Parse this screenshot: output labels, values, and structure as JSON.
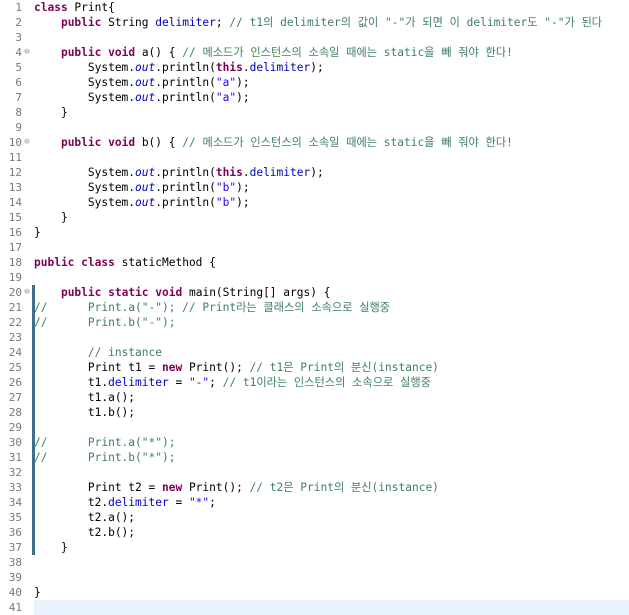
{
  "editor": {
    "language": "java",
    "colors": {
      "keyword": "#7f0055",
      "field": "#0000c0",
      "string": "#2a00ff",
      "comment": "#3f7f5f",
      "line_number": "#787878",
      "current_line": "#e8f2fe",
      "change_marker": "#3d6f8a"
    },
    "fold_icon": "collapse-minus-icon",
    "current_line": 41,
    "lines": [
      {
        "n": "1",
        "fold": false,
        "mark": false,
        "tokens": [
          {
            "t": "kw",
            "v": "class"
          },
          {
            "t": "p",
            "v": " Print{"
          }
        ]
      },
      {
        "n": "2",
        "fold": false,
        "mark": false,
        "tokens": [
          {
            "t": "p",
            "v": "    "
          },
          {
            "t": "kw",
            "v": "public"
          },
          {
            "t": "p",
            "v": " String "
          },
          {
            "t": "fld",
            "v": "delimiter"
          },
          {
            "t": "p",
            "v": "; "
          },
          {
            "t": "cm",
            "v": "// t1의 delimiter의 값이 \"-\"가 되면 이 delimiter도 \"-\"가 된다"
          }
        ]
      },
      {
        "n": "3",
        "fold": false,
        "mark": false,
        "tokens": []
      },
      {
        "n": "4",
        "fold": true,
        "mark": false,
        "tokens": [
          {
            "t": "p",
            "v": "    "
          },
          {
            "t": "kw",
            "v": "public"
          },
          {
            "t": "p",
            "v": " "
          },
          {
            "t": "kw",
            "v": "void"
          },
          {
            "t": "p",
            "v": " a() { "
          },
          {
            "t": "cm",
            "v": "// 메소드가 인스턴스의 소속일 때에는 static을 빼 줘야 한다!"
          }
        ]
      },
      {
        "n": "5",
        "fold": false,
        "mark": false,
        "tokens": [
          {
            "t": "p",
            "v": "        System."
          },
          {
            "t": "sfld",
            "v": "out"
          },
          {
            "t": "p",
            "v": ".println("
          },
          {
            "t": "kw",
            "v": "this"
          },
          {
            "t": "p",
            "v": "."
          },
          {
            "t": "fld",
            "v": "delimiter"
          },
          {
            "t": "p",
            "v": ");"
          }
        ]
      },
      {
        "n": "6",
        "fold": false,
        "mark": false,
        "tokens": [
          {
            "t": "p",
            "v": "        System."
          },
          {
            "t": "sfld",
            "v": "out"
          },
          {
            "t": "p",
            "v": ".println("
          },
          {
            "t": "str",
            "v": "\"a\""
          },
          {
            "t": "p",
            "v": ");"
          }
        ]
      },
      {
        "n": "7",
        "fold": false,
        "mark": false,
        "tokens": [
          {
            "t": "p",
            "v": "        System."
          },
          {
            "t": "sfld",
            "v": "out"
          },
          {
            "t": "p",
            "v": ".println("
          },
          {
            "t": "str",
            "v": "\"a\""
          },
          {
            "t": "p",
            "v": ");"
          }
        ]
      },
      {
        "n": "8",
        "fold": false,
        "mark": false,
        "tokens": [
          {
            "t": "p",
            "v": "    }"
          }
        ]
      },
      {
        "n": "9",
        "fold": false,
        "mark": false,
        "tokens": []
      },
      {
        "n": "10",
        "fold": true,
        "mark": false,
        "tokens": [
          {
            "t": "p",
            "v": "    "
          },
          {
            "t": "kw",
            "v": "public"
          },
          {
            "t": "p",
            "v": " "
          },
          {
            "t": "kw",
            "v": "void"
          },
          {
            "t": "p",
            "v": " b() { "
          },
          {
            "t": "cm",
            "v": "// 메소드가 인스턴스의 소속일 때에는 static을 빼 줘야 한다!"
          }
        ]
      },
      {
        "n": "11",
        "fold": false,
        "mark": false,
        "tokens": []
      },
      {
        "n": "12",
        "fold": false,
        "mark": false,
        "tokens": [
          {
            "t": "p",
            "v": "        System."
          },
          {
            "t": "sfld",
            "v": "out"
          },
          {
            "t": "p",
            "v": ".println("
          },
          {
            "t": "kw",
            "v": "this"
          },
          {
            "t": "p",
            "v": "."
          },
          {
            "t": "fld",
            "v": "delimiter"
          },
          {
            "t": "p",
            "v": ");"
          }
        ]
      },
      {
        "n": "13",
        "fold": false,
        "mark": false,
        "tokens": [
          {
            "t": "p",
            "v": "        System."
          },
          {
            "t": "sfld",
            "v": "out"
          },
          {
            "t": "p",
            "v": ".println("
          },
          {
            "t": "str",
            "v": "\"b\""
          },
          {
            "t": "p",
            "v": ");"
          }
        ]
      },
      {
        "n": "14",
        "fold": false,
        "mark": false,
        "tokens": [
          {
            "t": "p",
            "v": "        System."
          },
          {
            "t": "sfld",
            "v": "out"
          },
          {
            "t": "p",
            "v": ".println("
          },
          {
            "t": "str",
            "v": "\"b\""
          },
          {
            "t": "p",
            "v": ");"
          }
        ]
      },
      {
        "n": "15",
        "fold": false,
        "mark": false,
        "tokens": [
          {
            "t": "p",
            "v": "    }"
          }
        ]
      },
      {
        "n": "16",
        "fold": false,
        "mark": false,
        "tokens": [
          {
            "t": "p",
            "v": "}"
          }
        ]
      },
      {
        "n": "17",
        "fold": false,
        "mark": false,
        "tokens": []
      },
      {
        "n": "18",
        "fold": false,
        "mark": false,
        "tokens": [
          {
            "t": "kw",
            "v": "public"
          },
          {
            "t": "p",
            "v": " "
          },
          {
            "t": "kw",
            "v": "class"
          },
          {
            "t": "p",
            "v": " staticMethod {"
          }
        ]
      },
      {
        "n": "19",
        "fold": false,
        "mark": false,
        "tokens": []
      },
      {
        "n": "20",
        "fold": true,
        "mark": true,
        "tokens": [
          {
            "t": "p",
            "v": "    "
          },
          {
            "t": "kw",
            "v": "public"
          },
          {
            "t": "p",
            "v": " "
          },
          {
            "t": "kw",
            "v": "static"
          },
          {
            "t": "p",
            "v": " "
          },
          {
            "t": "kw",
            "v": "void"
          },
          {
            "t": "p",
            "v": " main(String[] args) {"
          }
        ]
      },
      {
        "n": "21",
        "fold": false,
        "mark": true,
        "tokens": [
          {
            "t": "cm",
            "v": "//      Print.a(\"-\"); // Print라는 클래스의 소속으로 실행중"
          }
        ]
      },
      {
        "n": "22",
        "fold": false,
        "mark": true,
        "tokens": [
          {
            "t": "cm",
            "v": "//      Print.b(\"-\");"
          }
        ]
      },
      {
        "n": "23",
        "fold": false,
        "mark": true,
        "tokens": []
      },
      {
        "n": "24",
        "fold": false,
        "mark": true,
        "tokens": [
          {
            "t": "p",
            "v": "        "
          },
          {
            "t": "cm",
            "v": "// instance"
          }
        ]
      },
      {
        "n": "25",
        "fold": false,
        "mark": true,
        "tokens": [
          {
            "t": "p",
            "v": "        Print t1 = "
          },
          {
            "t": "kw",
            "v": "new"
          },
          {
            "t": "p",
            "v": " Print(); "
          },
          {
            "t": "cm",
            "v": "// t1은 Print의 분신(instance)"
          }
        ]
      },
      {
        "n": "26",
        "fold": false,
        "mark": true,
        "tokens": [
          {
            "t": "p",
            "v": "        t1."
          },
          {
            "t": "fld",
            "v": "delimiter"
          },
          {
            "t": "p",
            "v": " = "
          },
          {
            "t": "str",
            "v": "\"-\""
          },
          {
            "t": "p",
            "v": "; "
          },
          {
            "t": "cm",
            "v": "// t1이라는 인스턴스의 소속으로 실행중"
          }
        ]
      },
      {
        "n": "27",
        "fold": false,
        "mark": true,
        "tokens": [
          {
            "t": "p",
            "v": "        t1.a();"
          }
        ]
      },
      {
        "n": "28",
        "fold": false,
        "mark": true,
        "tokens": [
          {
            "t": "p",
            "v": "        t1.b();"
          }
        ]
      },
      {
        "n": "29",
        "fold": false,
        "mark": true,
        "tokens": []
      },
      {
        "n": "30",
        "fold": false,
        "mark": true,
        "tokens": [
          {
            "t": "cm",
            "v": "//      Print.a(\"*\");"
          }
        ]
      },
      {
        "n": "31",
        "fold": false,
        "mark": true,
        "tokens": [
          {
            "t": "cm",
            "v": "//      Print.b(\"*\");"
          }
        ]
      },
      {
        "n": "32",
        "fold": false,
        "mark": true,
        "tokens": []
      },
      {
        "n": "33",
        "fold": false,
        "mark": true,
        "tokens": [
          {
            "t": "p",
            "v": "        Print t2 = "
          },
          {
            "t": "kw",
            "v": "new"
          },
          {
            "t": "p",
            "v": " Print(); "
          },
          {
            "t": "cm",
            "v": "// t2은 Print의 분신(instance)"
          }
        ]
      },
      {
        "n": "34",
        "fold": false,
        "mark": true,
        "tokens": [
          {
            "t": "p",
            "v": "        t2."
          },
          {
            "t": "fld",
            "v": "delimiter"
          },
          {
            "t": "p",
            "v": " = "
          },
          {
            "t": "str",
            "v": "\"*\""
          },
          {
            "t": "p",
            "v": ";"
          }
        ]
      },
      {
        "n": "35",
        "fold": false,
        "mark": true,
        "tokens": [
          {
            "t": "p",
            "v": "        t2.a();"
          }
        ]
      },
      {
        "n": "36",
        "fold": false,
        "mark": true,
        "tokens": [
          {
            "t": "p",
            "v": "        t2.b();"
          }
        ]
      },
      {
        "n": "37",
        "fold": false,
        "mark": true,
        "tokens": [
          {
            "t": "p",
            "v": "    }"
          }
        ]
      },
      {
        "n": "38",
        "fold": false,
        "mark": false,
        "tokens": []
      },
      {
        "n": "39",
        "fold": false,
        "mark": false,
        "tokens": []
      },
      {
        "n": "40",
        "fold": false,
        "mark": false,
        "tokens": [
          {
            "t": "p",
            "v": "}"
          }
        ]
      },
      {
        "n": "41",
        "fold": false,
        "mark": false,
        "tokens": []
      }
    ]
  }
}
